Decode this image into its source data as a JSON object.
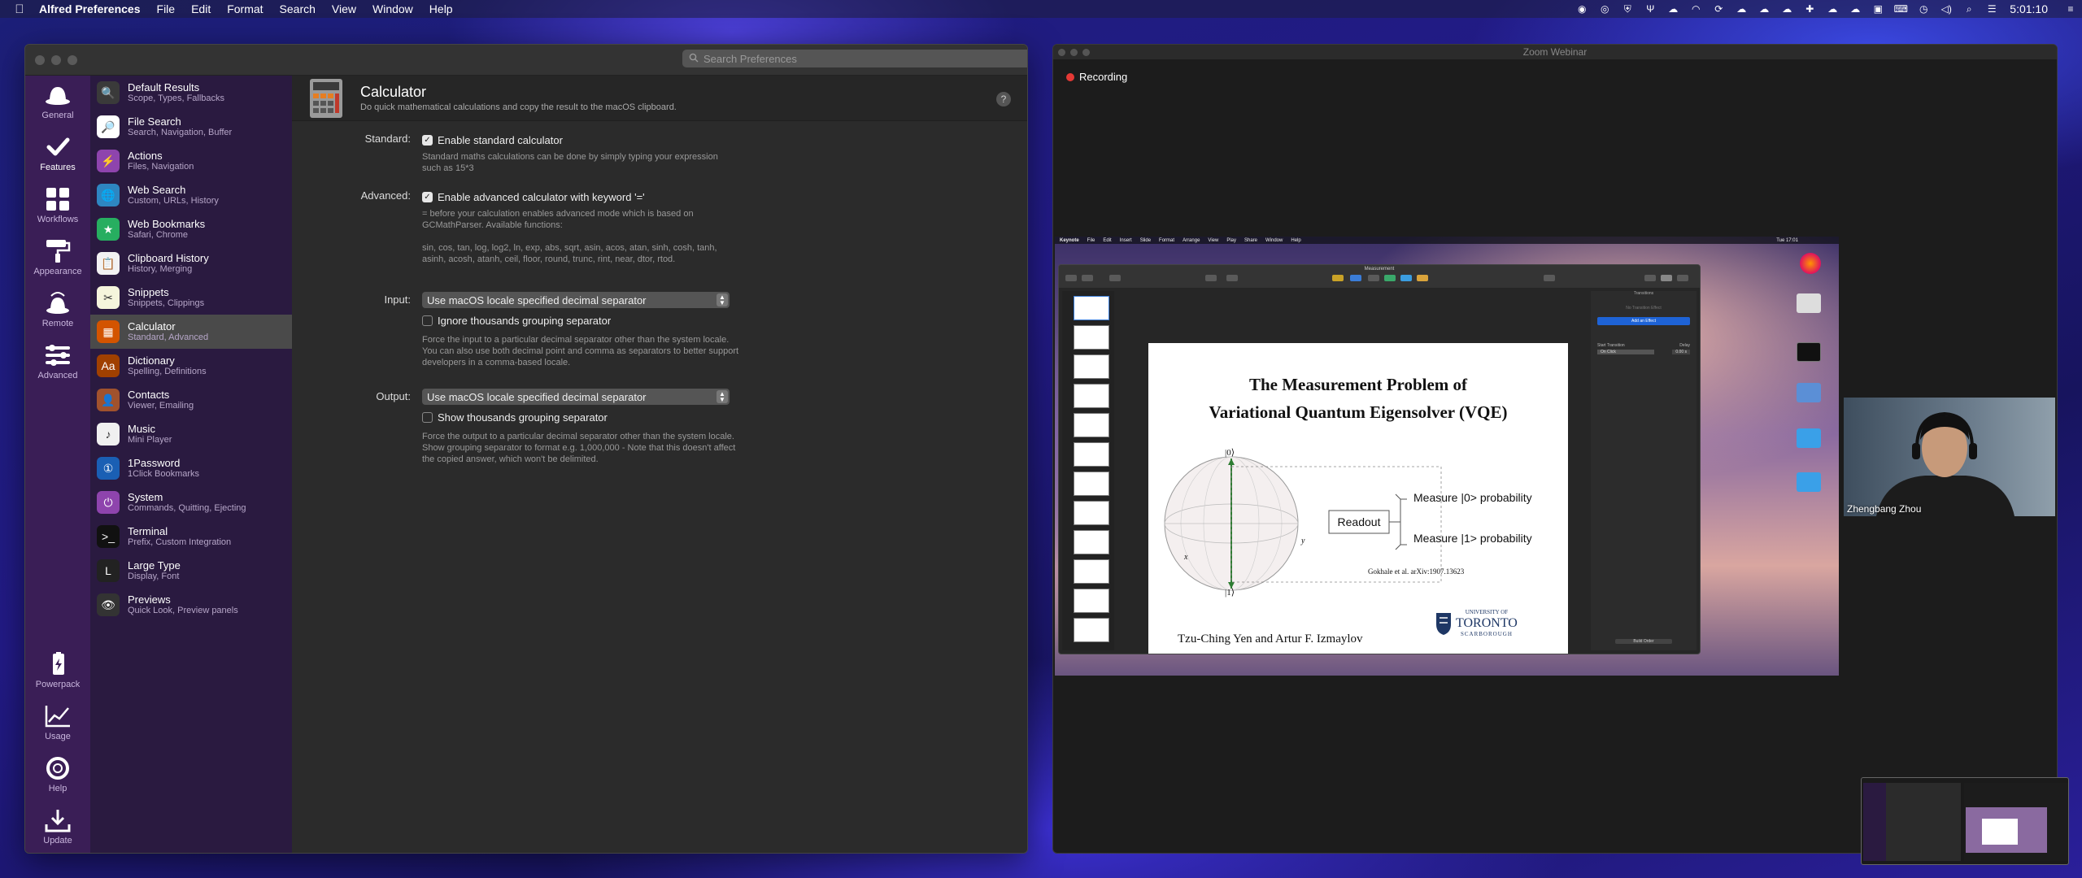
{
  "menubar": {
    "app_name": "Alfred Preferences",
    "menus": [
      "File",
      "Edit",
      "Format",
      "Search",
      "View",
      "Window",
      "Help"
    ],
    "clock": "5:01:10",
    "status_icons": [
      "alfred-icon",
      "1password-icon",
      "shield-icon",
      "fork-icon",
      "cloud-icon",
      "headset-icon",
      "cloud-sync-icon",
      "cloud-upload-icon",
      "cloud-download-icon",
      "cloud-upload-icon",
      "medical-cross-icon",
      "cloud-icon",
      "cloud-icon",
      "screen-share-icon",
      "keyboard-icon",
      "time-machine-icon",
      "volume-icon",
      "spotlight-icon",
      "control-center-icon"
    ]
  },
  "alfred": {
    "search_placeholder": "Search Preferences",
    "rail": [
      {
        "label": "General",
        "icon": "hat-icon"
      },
      {
        "label": "Features",
        "icon": "checkmark-icon",
        "active": true
      },
      {
        "label": "Workflows",
        "icon": "grid-icon"
      },
      {
        "label": "Appearance",
        "icon": "paint-roller-icon"
      },
      {
        "label": "Remote",
        "icon": "remote-icon"
      },
      {
        "label": "Advanced",
        "icon": "sliders-icon"
      }
    ],
    "rail_bottom": [
      {
        "label": "Powerpack",
        "icon": "battery-icon"
      },
      {
        "label": "Usage",
        "icon": "chart-icon"
      },
      {
        "label": "Help",
        "icon": "lifebuoy-icon"
      },
      {
        "label": "Update",
        "icon": "download-icon"
      }
    ],
    "features": [
      {
        "title": "Default Results",
        "sub": "Scope, Types, Fallbacks",
        "color": "#3a3a3a",
        "glyph": "🔍"
      },
      {
        "title": "File Search",
        "sub": "Search, Navigation, Buffer",
        "color": "#ffffff",
        "glyph": "🔎"
      },
      {
        "title": "Actions",
        "sub": "Files, Navigation",
        "color": "#8e44ad",
        "glyph": "⚡"
      },
      {
        "title": "Web Search",
        "sub": "Custom, URLs, History",
        "color": "#2e86c1",
        "glyph": "🌐"
      },
      {
        "title": "Web Bookmarks",
        "sub": "Safari, Chrome",
        "color": "#27ae60",
        "glyph": "★"
      },
      {
        "title": "Clipboard History",
        "sub": "History, Merging",
        "color": "#f2f2f2",
        "glyph": "📋"
      },
      {
        "title": "Snippets",
        "sub": "Snippets, Clippings",
        "color": "#f5f5dc",
        "glyph": "✂"
      },
      {
        "title": "Calculator",
        "sub": "Standard, Advanced",
        "color": "#d35400",
        "glyph": "▦",
        "active": true
      },
      {
        "title": "Dictionary",
        "sub": "Spelling, Definitions",
        "color": "#a04000",
        "glyph": "Aa"
      },
      {
        "title": "Contacts",
        "sub": "Viewer, Emailing",
        "color": "#a0522d",
        "glyph": "👤"
      },
      {
        "title": "Music",
        "sub": "Mini Player",
        "color": "#f0f0f0",
        "glyph": "♪"
      },
      {
        "title": "1Password",
        "sub": "1Click Bookmarks",
        "color": "#1a5fb4",
        "glyph": "①"
      },
      {
        "title": "System",
        "sub": "Commands, Quitting, Ejecting",
        "color": "#8e44ad",
        "glyph": "⏻"
      },
      {
        "title": "Terminal",
        "sub": "Prefix, Custom Integration",
        "color": "#111111",
        "glyph": ">_"
      },
      {
        "title": "Large Type",
        "sub": "Display, Font",
        "color": "#222222",
        "glyph": "L"
      },
      {
        "title": "Previews",
        "sub": "Quick Look, Preview panels",
        "color": "#333333",
        "glyph": "👁"
      }
    ],
    "content": {
      "title": "Calculator",
      "subtitle": "Do quick mathematical calculations and copy the result to the macOS clipboard.",
      "standard": {
        "label": "Standard:",
        "check": "Enable standard calculator",
        "desc1": "Standard maths calculations can be done by simply typing your expression",
        "desc2": "such as 15*3"
      },
      "advanced": {
        "label": "Advanced:",
        "check": "Enable advanced calculator with keyword '='",
        "desc1": "= before your calculation enables advanced mode which is based on",
        "desc2": "GCMathParser. Available functions:",
        "desc3": "sin, cos, tan, log, log2, ln, exp, abs, sqrt, asin, acos, atan, sinh, cosh, tanh,",
        "desc4": "asinh, acosh, atanh, ceil, floor, round, trunc, rint, near, dtor, rtod."
      },
      "input": {
        "label": "Input:",
        "select": "Use macOS locale specified decimal separator",
        "check": "Ignore thousands grouping separator",
        "desc1": "Force the input to a particular decimal separator other than the system locale.",
        "desc2": "You can also use both decimal point and comma as separators to better support",
        "desc3": "developers in a comma-based locale."
      },
      "output": {
        "label": "Output:",
        "select": "Use macOS locale specified decimal separator",
        "check": "Show thousands grouping separator",
        "desc1": "Force the output to a particular decimal separator other than the system locale.",
        "desc2": "Show grouping separator to format e.g. 1,000,000 - Note that this doesn't affect",
        "desc3": "the copied answer, which won't be delimited."
      }
    }
  },
  "zoom": {
    "title": "Zoom Webinar",
    "recording": "Recording",
    "participant_name": "Zhengbang Zhou",
    "inner_menus": [
      "Keynote",
      "File",
      "Edit",
      "Insert",
      "Slide",
      "Format",
      "Arrange",
      "View",
      "Play",
      "Share",
      "Window",
      "Help"
    ],
    "inner_clock": "Tue 17:01",
    "keynote_doc": "Measurement",
    "slide": {
      "title_line1": "The Measurement Problem of",
      "title_line2": "Variational Quantum Eigensolver (VQE)",
      "ket0": "|0⟩",
      "ket1": "|1⟩",
      "axis_x": "x",
      "axis_y": "y",
      "readout": "Readout",
      "measure0": "Measure |0> probability",
      "measure1": "Measure |1> probability",
      "citation": "Gokhale et al. arXiv:1907.13623",
      "authors": "Tzu-Ching Yen and Artur F. Izmaylov",
      "uni_top": "UNIVERSITY OF",
      "uni_mid": "TORONTO",
      "uni_bot": "SCARBOROUGH"
    },
    "inspector": {
      "tab": "Transitions",
      "no_transition": "No Transition Effect",
      "add_effect": "Add an Effect",
      "start_transition": "Start Transition",
      "delay": "Delay",
      "on_click": "On Click",
      "delay_value": "0.00 s",
      "build_order": "Build Order"
    }
  }
}
